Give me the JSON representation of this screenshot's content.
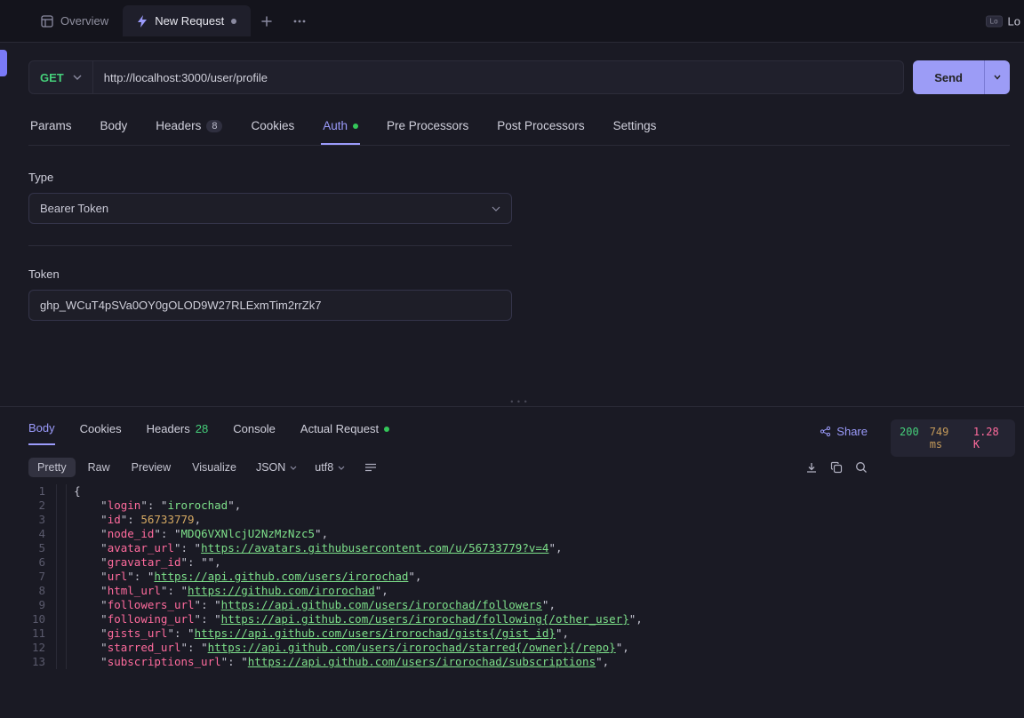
{
  "tabs": {
    "overview_label": "Overview",
    "new_request_label": "New Request",
    "login_text": "Lo",
    "login_badge": "Lo"
  },
  "request": {
    "method": "GET",
    "url": "http://localhost:3000/user/profile",
    "send_label": "Send"
  },
  "req_tabs": {
    "params": "Params",
    "body": "Body",
    "headers": "Headers",
    "headers_count": "8",
    "cookies": "Cookies",
    "auth": "Auth",
    "pre": "Pre Processors",
    "post": "Post Processors",
    "settings": "Settings"
  },
  "auth_form": {
    "type_label": "Type",
    "type_value": "Bearer Token",
    "token_label": "Token",
    "token_value": "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"
  },
  "resp_tabs": {
    "body": "Body",
    "cookies": "Cookies",
    "headers": "Headers",
    "headers_count": "28",
    "console": "Console",
    "actual": "Actual Request",
    "share": "Share"
  },
  "toolbar": {
    "pretty": "Pretty",
    "raw": "Raw",
    "preview": "Preview",
    "visualize": "Visualize",
    "format": "JSON",
    "encoding": "utf8"
  },
  "status": {
    "code": "200",
    "time": "749 ms",
    "size": "1.28 K"
  },
  "response_body": {
    "login": "irorochad",
    "id": 56733779,
    "node_id": "MDQ6VXNlcjU2NzMzNzc5",
    "avatar_url": "https://avatars.githubusercontent.com/u/56733779?v=4",
    "gravatar_id": "",
    "url": "https://api.github.com/users/irorochad",
    "html_url": "https://github.com/irorochad",
    "followers_url": "https://api.github.com/users/irorochad/followers",
    "following_url": "https://api.github.com/users/irorochad/following{/other_user}",
    "gists_url": "https://api.github.com/users/irorochad/gists{/gist_id}",
    "starred_url": "https://api.github.com/users/irorochad/starred{/owner}{/repo}",
    "subscriptions_url": "https://api.github.com/users/irorochad/subscriptions"
  }
}
